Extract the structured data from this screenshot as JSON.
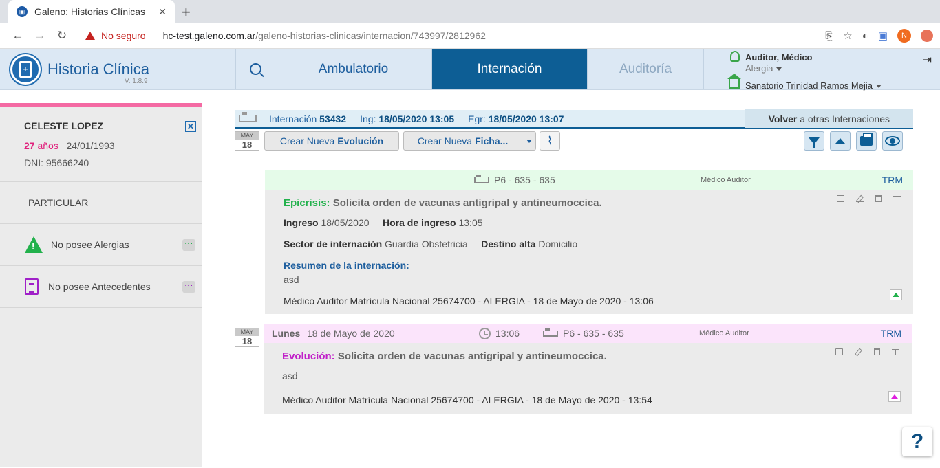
{
  "browser": {
    "tab_title": "Galeno: Historias Clínicas",
    "warning": "No seguro",
    "url_host": "hc-test.galeno.com.ar",
    "url_path": "/galeno-historias-clinicas/internacion/743997/2812962",
    "profile_initial": "N"
  },
  "app": {
    "brand": "Historia Clínica",
    "version": "V. 1.8.9",
    "tabs": [
      {
        "label": "Ambulatorio",
        "state": "normal"
      },
      {
        "label": "Internación",
        "state": "active"
      },
      {
        "label": "Auditoría",
        "state": "disabled"
      }
    ],
    "user_role": "Auditor, Médico",
    "user_sub": "Alergia",
    "institution": "Sanatorio Trinidad Ramos Mejia"
  },
  "patient": {
    "name": "CELESTE LOPEZ",
    "age": "27",
    "age_unit": "años",
    "birth": "24/01/1993",
    "dni": "DNI: 95666240",
    "coverage": "PARTICULAR",
    "allergies": "No posee Alergias",
    "background": "No posee Antecedentes"
  },
  "internacion": {
    "label": "Internación",
    "number": "53432",
    "ing_label": "Ing:",
    "ing": "18/05/2020 13:05",
    "egr_label": "Egr:",
    "egr": "18/05/2020 13:07",
    "volver_bold": "Volver",
    "volver_rest": "a otras Internaciones"
  },
  "toolbar": {
    "cal_month": "MAY",
    "cal_day": "18",
    "new_evol_prefix": "Crear Nueva",
    "new_evol_bold": "Evolución",
    "new_ficha_prefix": "Crear Nueva",
    "new_ficha_bold": "Ficha..."
  },
  "card1": {
    "location": "P6 - 635 - 635",
    "role": "Médico Auditor",
    "center": "TRM",
    "type_label": "Epicrisis:",
    "title": "Solicita orden de vacunas antigripal y antineumoccica.",
    "ingreso_label": "Ingreso",
    "ingreso": "18/05/2020",
    "hora_label": "Hora de ingreso",
    "hora": "13:05",
    "sector_label": "Sector de internación",
    "sector": "Guardia Obstetricia",
    "destino_label": "Destino alta",
    "destino": "Domicilio",
    "resumen_label": "Resumen de la internación:",
    "resumen": "asd",
    "footer": "Médico Auditor Matrícula Nacional 25674700 - ALERGIA - 18 de Mayo de 2020 - 13:06"
  },
  "card2": {
    "cal_month": "MAY",
    "cal_day": "18",
    "weekday": "Lunes",
    "date": "18 de Mayo de 2020",
    "time": "13:06",
    "location": "P6 - 635 - 635",
    "role": "Médico Auditor",
    "center": "TRM",
    "type_label": "Evolución:",
    "title": "Solicita orden de vacunas antigripal y antineumoccica.",
    "text": "asd",
    "footer": "Médico Auditor Matrícula Nacional 25674700 - ALERGIA - 18 de Mayo de 2020 - 13:54"
  },
  "help": "?",
  "colors": {
    "accent": "#0d5e95",
    "epicrisis": "#22b14c",
    "evolucion": "#c020c8",
    "patient_bar": "#f46aa3"
  }
}
